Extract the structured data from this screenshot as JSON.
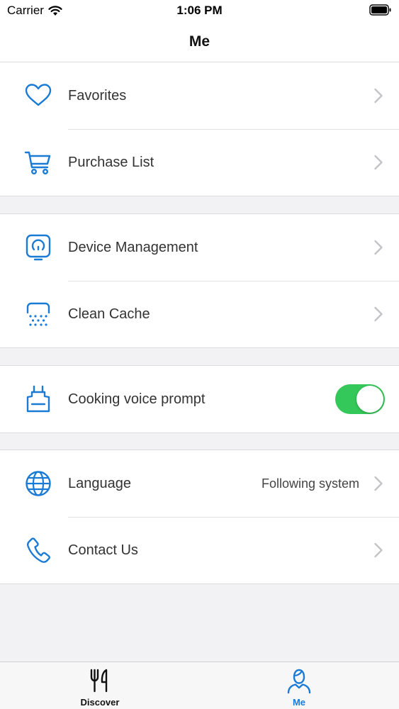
{
  "status_bar": {
    "carrier": "Carrier",
    "time": "1:06 PM"
  },
  "nav": {
    "title": "Me"
  },
  "groups": [
    {
      "items": [
        {
          "label": "Favorites",
          "icon": "heart-icon"
        },
        {
          "label": "Purchase List",
          "icon": "cart-icon"
        }
      ]
    },
    {
      "items": [
        {
          "label": "Device Management",
          "icon": "device-icon"
        },
        {
          "label": "Clean Cache",
          "icon": "clean-cache-icon"
        }
      ]
    },
    {
      "items": [
        {
          "label": "Cooking voice prompt",
          "icon": "apron-icon",
          "toggle": true
        }
      ]
    },
    {
      "items": [
        {
          "label": "Language",
          "icon": "globe-icon",
          "value": "Following system"
        },
        {
          "label": "Contact Us",
          "icon": "phone-icon"
        }
      ]
    }
  ],
  "tabs": [
    {
      "label": "Discover",
      "icon": "utensils-icon",
      "active": false
    },
    {
      "label": "Me",
      "icon": "person-icon",
      "active": true
    }
  ],
  "colors": {
    "accent": "#1a7bd6",
    "toggle_on": "#34c759",
    "chevron": "#c4c4c8",
    "tab_inactive": "#111111"
  }
}
